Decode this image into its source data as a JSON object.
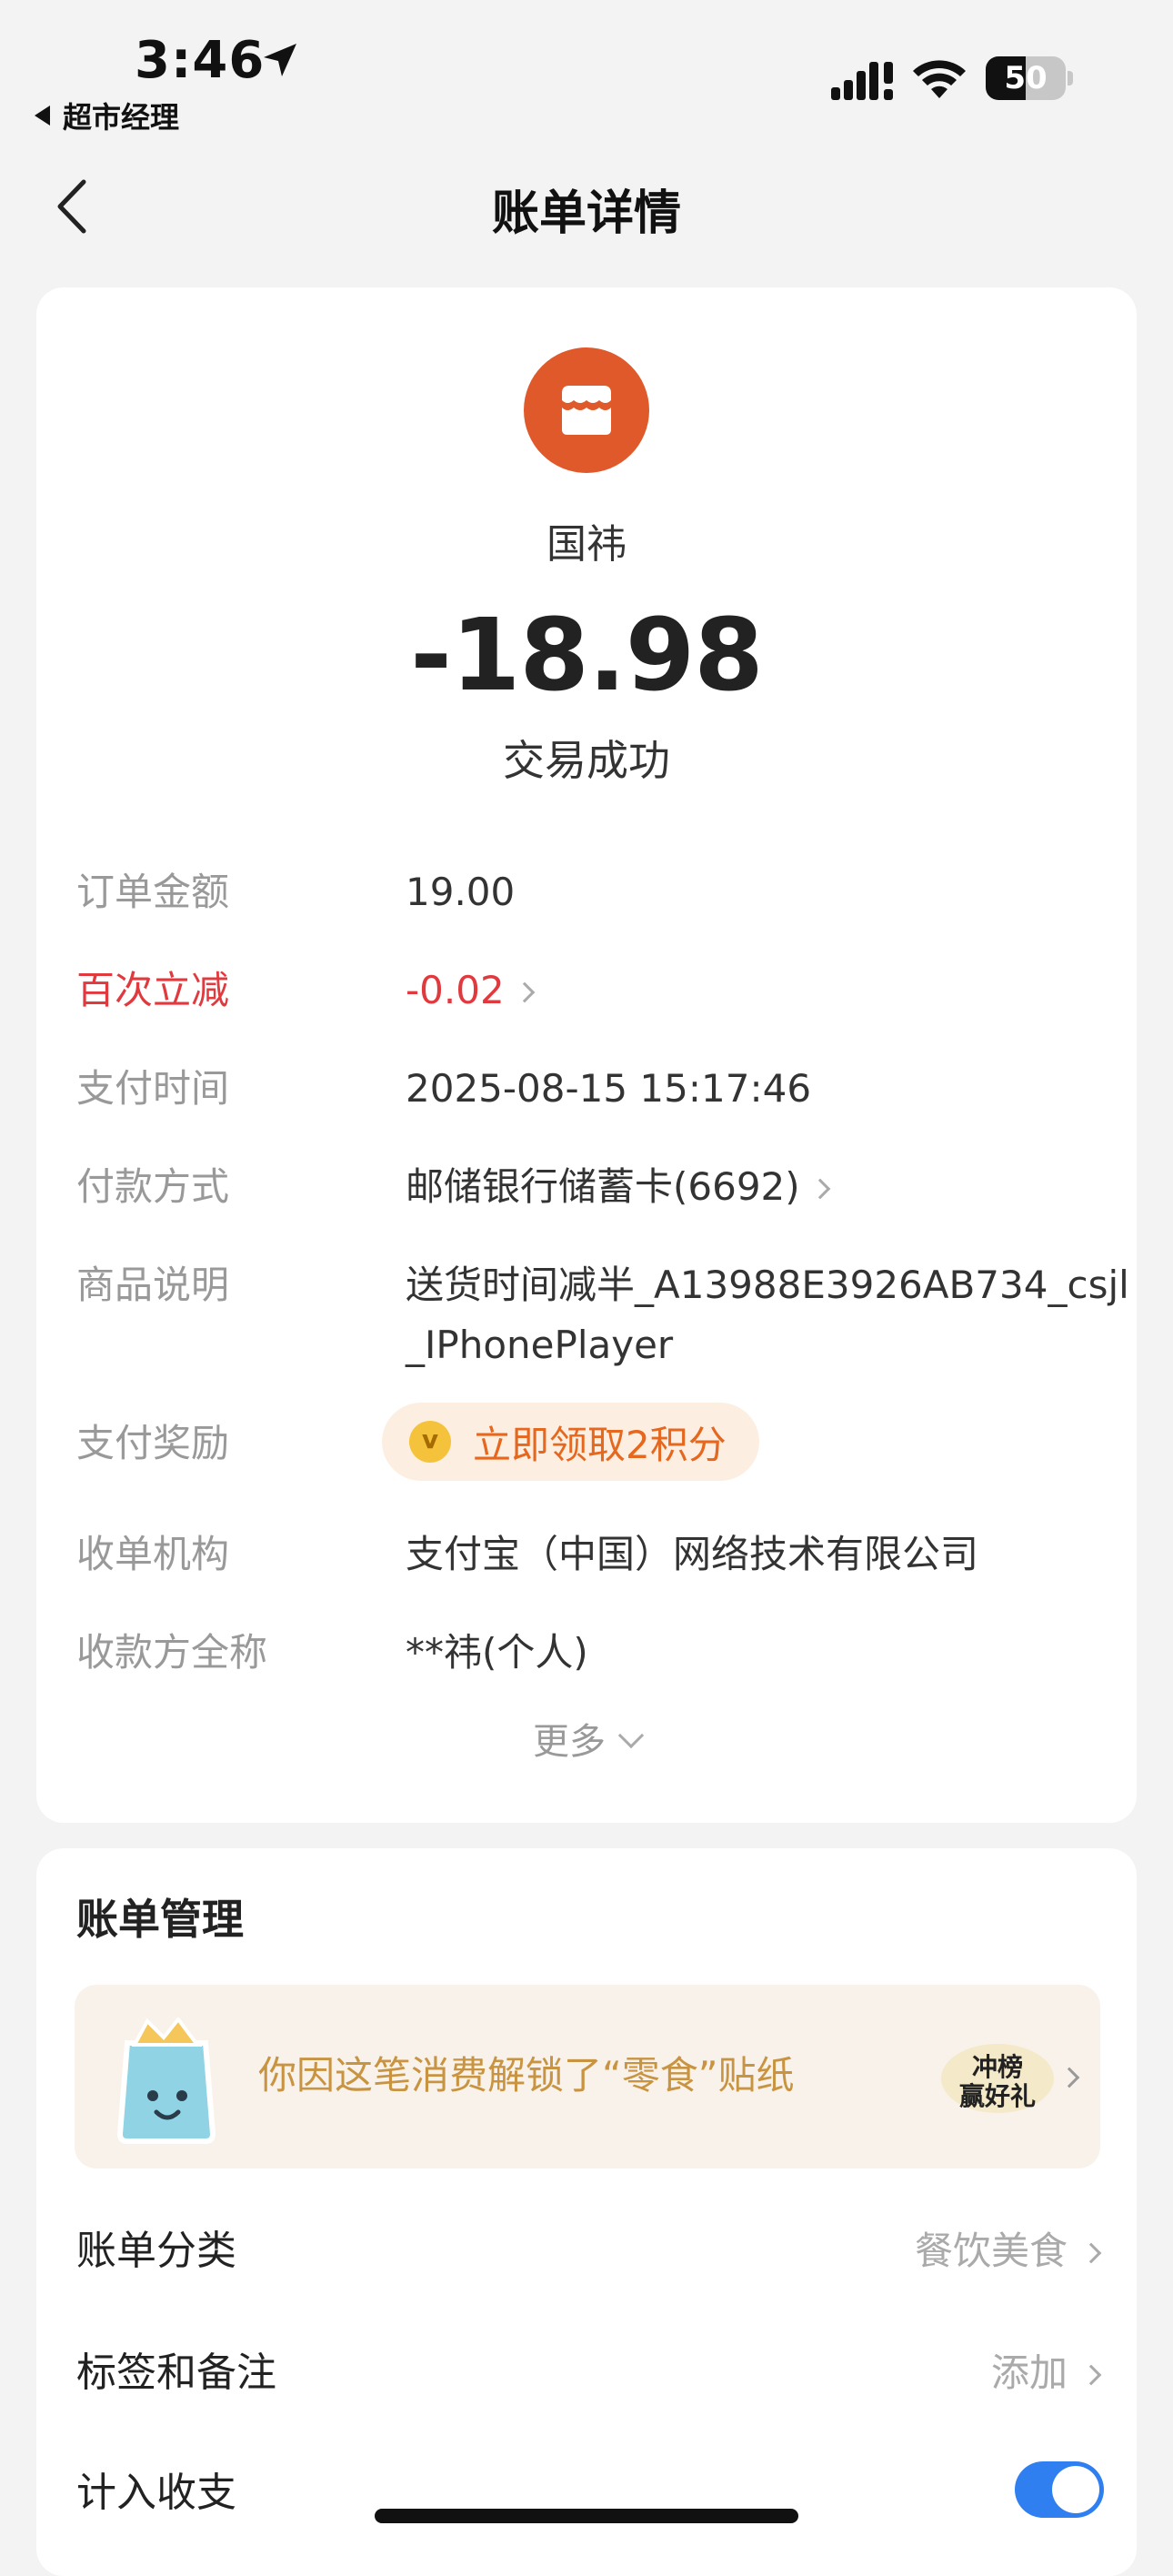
{
  "status_bar": {
    "time": "3:46",
    "back_app": "超市经理",
    "battery": 50
  },
  "nav": {
    "title": "账单详情"
  },
  "summary": {
    "merchant_name": "国祎",
    "amount": "-18.98",
    "status": "交易成功"
  },
  "details": [
    {
      "label": "订单金额",
      "value": "19.00"
    },
    {
      "label": "百次立减",
      "value": "-0.02"
    },
    {
      "label": "支付时间",
      "value": "2025-08-15 15:17:46"
    },
    {
      "label": "付款方式",
      "value": "邮储银行储蓄卡(6692)"
    },
    {
      "label": "商品说明",
      "value": "送货时间减半_A13988E3926AB734_csjl_IPhonePlayer"
    },
    {
      "label": "支付奖励",
      "value": "立即领取2积分"
    },
    {
      "label": "收单机构",
      "value": "支付宝（中国）网络技术有限公司"
    },
    {
      "label": "收款方全称",
      "value": "**祎(个人)"
    }
  ],
  "more_label": "更多",
  "manage": {
    "title": "账单管理",
    "sticker_text": "你因这笔消费解锁了“零食”贴纸",
    "sticker_badge": "冲榜赢好礼",
    "category_label": "账单分类",
    "category_value": "餐饮美食",
    "tags_label": "标签和备注",
    "tags_value": "添加",
    "include_label": "计入收支",
    "include_on": true
  },
  "colors": {
    "merchant_icon": "#e0592b",
    "discount_red": "#e0393e",
    "reward_orange": "#e6671e",
    "toggle_blue": "#2f7ff0"
  }
}
